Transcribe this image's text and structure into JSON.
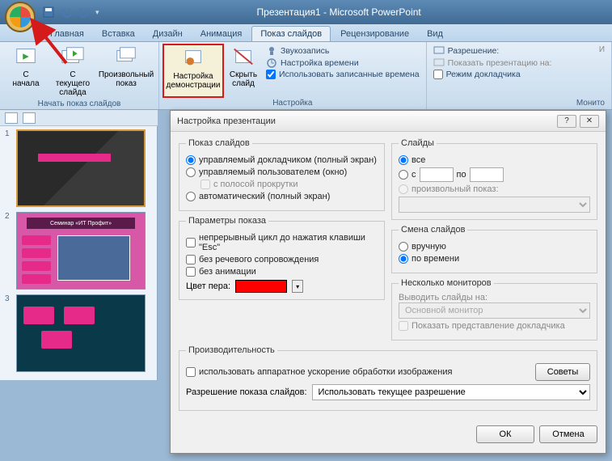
{
  "titlebar": {
    "title": "Презентация1 - Microsoft PowerPoint"
  },
  "tabs": {
    "home": "Главная",
    "insert": "Вставка",
    "design": "Дизайн",
    "animation": "Анимация",
    "slideshow": "Показ слайдов",
    "review": "Рецензирование",
    "view": "Вид"
  },
  "ribbon": {
    "from_start": "С\nначала",
    "from_current": "С текущего\nслайда",
    "custom_show": "Произвольный\nпоказ",
    "setup_show": "Настройка\nдемонстрации",
    "hide_slide": "Скрыть\nслайд",
    "record_narration": "Звукозапись",
    "rehearse": "Настройка времени",
    "use_timings": "Использовать записанные времена",
    "resolution": "Разрешение:",
    "show_on": "Показать презентацию на:",
    "presenter_view": "Режим докладчика",
    "group_start": "Начать показ слайдов",
    "group_setup": "Настройка",
    "group_monitors": "Монито"
  },
  "thumbs": {
    "t2_title": "Семинар «ИТ Профит»"
  },
  "dialog": {
    "title": "Настройка презентации",
    "show_type": {
      "legend": "Показ слайдов",
      "presenter": "управляемый докладчиком (полный экран)",
      "browsed": "управляемый пользователем (окно)",
      "scrollbar": "с полосой прокрутки",
      "kiosk": "автоматический (полный экран)"
    },
    "show_options": {
      "legend": "Параметры показа",
      "loop": "непрерывный цикл до нажатия клавиши \"Esc\"",
      "no_narration": "без речевого сопровождения",
      "no_animation": "без анимации",
      "pen_color": "Цвет пера:"
    },
    "slides": {
      "legend": "Слайды",
      "all": "все",
      "from": "с",
      "to": "по",
      "custom": "произвольный показ:"
    },
    "advance": {
      "legend": "Смена слайдов",
      "manual": "вручную",
      "timings": "по времени"
    },
    "monitors": {
      "legend": "Несколько мониторов",
      "display_on": "Выводить слайды на:",
      "primary": "Основной монитор",
      "presenter": "Показать представление докладчика"
    },
    "performance": {
      "legend": "Производительность",
      "hw": "использовать аппаратное ускорение обработки изображения",
      "tips": "Советы",
      "resolution_label": "Разрешение показа слайдов:",
      "resolution_value": "Использовать текущее разрешение"
    },
    "buttons": {
      "ok": "ОК",
      "cancel": "Отмена"
    },
    "help": "?",
    "close": "✕"
  }
}
